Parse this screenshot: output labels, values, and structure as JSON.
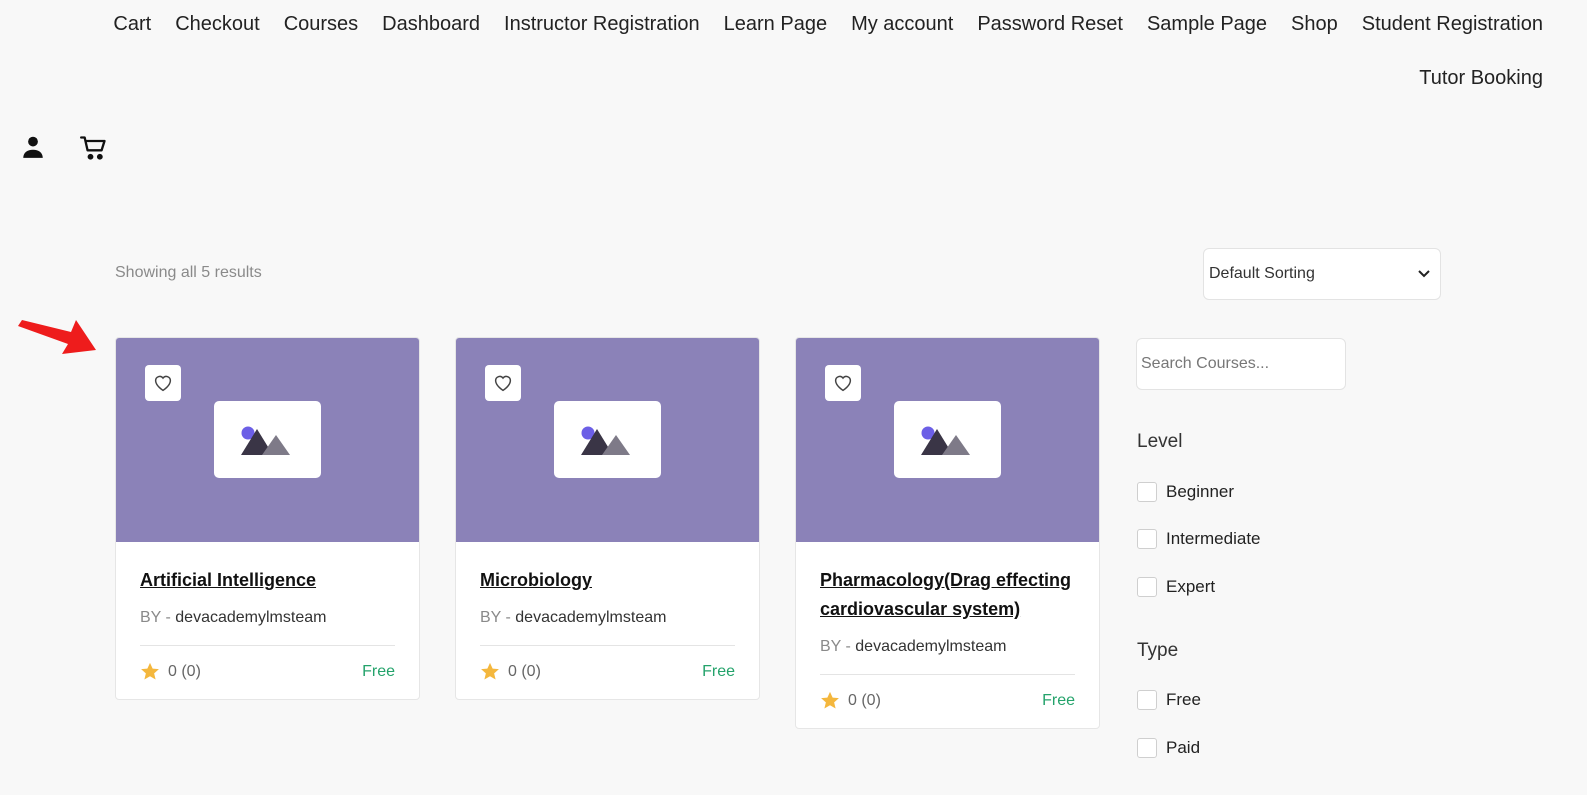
{
  "nav": {
    "items": [
      "Cart",
      "Checkout",
      "Courses",
      "Dashboard",
      "Instructor Registration",
      "Learn Page",
      "My account",
      "Password Reset",
      "Sample Page",
      "Shop",
      "Student Registration",
      "Tutor Booking"
    ]
  },
  "header": {
    "user_icon": "user-icon",
    "cart_icon": "cart-icon"
  },
  "toolbar": {
    "results_text": "Showing all 5 results",
    "sort_value": "Default Sorting"
  },
  "courses": [
    {
      "title": "Artificial Intelligence",
      "by_label": "BY -",
      "author": "devacademylmsteam",
      "rating": "0 (0)",
      "price": "Free"
    },
    {
      "title": "Microbiology",
      "by_label": "BY -",
      "author": "devacademylmsteam",
      "rating": "0 (0)",
      "price": "Free"
    },
    {
      "title": "Pharmacology(Drag effecting cardiovascular system)",
      "by_label": "BY -",
      "author": "devacademylmsteam",
      "rating": "0 (0)",
      "price": "Free"
    }
  ],
  "sidebar": {
    "search_placeholder": "Search Courses...",
    "level": {
      "title": "Level",
      "options": [
        "Beginner",
        "Intermediate",
        "Expert"
      ]
    },
    "type": {
      "title": "Type",
      "options": [
        "Free",
        "Paid"
      ]
    }
  },
  "colors": {
    "thumb": "#8b82b8",
    "price": "#24a36b",
    "star": "#f4b73d",
    "arrow": "#ee1c1c"
  }
}
